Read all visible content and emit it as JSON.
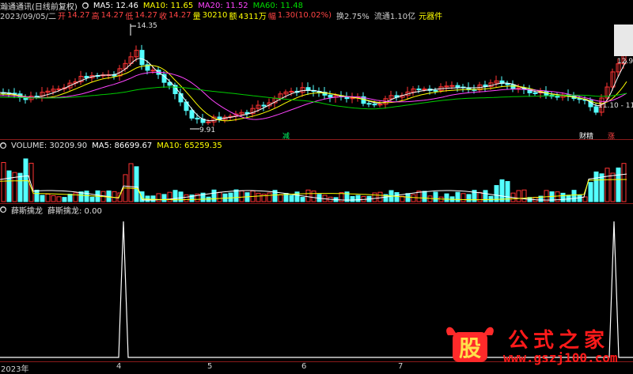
{
  "title_row": {
    "stock_name": "瀚通通讯(日线前复权)",
    "ma5": "MA5: 12.46",
    "ma10": "MA10: 11.65",
    "ma20": "MA20: 11.52",
    "ma60": "MA60: 11.48"
  },
  "info_row": {
    "date": "2023/09/05/二",
    "open_label": "开",
    "open": "14.27",
    "high_label": "高",
    "high": "14.27",
    "low_label": "低",
    "low": "14.27",
    "close_label": "收",
    "close": "14.27",
    "vol_label": "量",
    "vol": "30210",
    "amt_label": "额",
    "amt": "4311万",
    "chg_label": "幅",
    "chg": "1.30(10.02%)",
    "turn": "换2.75%",
    "float": "流通1.10亿",
    "sector": "元器件"
  },
  "price_labels": {
    "peak": "14.35",
    "trough": "9.91",
    "right_high": "12.97",
    "right_range": "11.10 - 11.2"
  },
  "markers": {
    "m1": "减",
    "m2": "财",
    "m3": "精",
    "m4": "涨"
  },
  "volume_row": {
    "label": "VOLUME: 30209.90",
    "ma5": "MA5: 86699.67",
    "ma10": "MA10: 65259.35"
  },
  "indicator_row": {
    "name": "薛斯擒龙",
    "value": "薛斯擒龙: 0.00"
  },
  "axis": {
    "year": "2023年",
    "ticks": [
      "4",
      "5",
      "6",
      "7"
    ]
  },
  "watermark": {
    "mascot": "股",
    "title": "公式之家",
    "url": "www.gszj100.com"
  },
  "colors": {
    "up": "#ff3333",
    "down": "#54ffff",
    "ma5": "#ffffff",
    "ma10": "#ffff00",
    "ma20": "#ff44ff",
    "ma60": "#00cc00",
    "separator": "#8a1a1a"
  }
}
